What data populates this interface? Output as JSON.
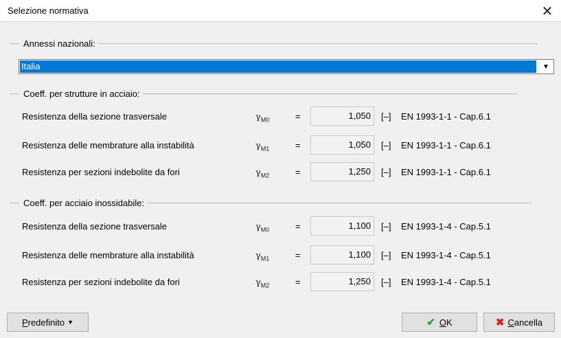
{
  "window": {
    "title": "Selezione normativa"
  },
  "annex": {
    "legend": "Annessi nazionali:",
    "selected": "Italia"
  },
  "steel": {
    "legend": "Coeff. per strutture in acciaio:",
    "rows": [
      {
        "label": "Resistenza della sezione trasversale",
        "symbol": "γ",
        "sub": "M0",
        "eq": "=",
        "value": "1,050",
        "unit": "[–]",
        "ref": "EN 1993-1-1 - Cap.6.1"
      },
      {
        "label": "Resistenza delle membrature alla instabilità",
        "symbol": "γ",
        "sub": "M1",
        "eq": "=",
        "value": "1,050",
        "unit": "[–]",
        "ref": "EN 1993-1-1 - Cap.6.1"
      },
      {
        "label": "Resistenza per sezioni indebolite da fori",
        "symbol": "γ",
        "sub": "M2",
        "eq": "=",
        "value": "1,250",
        "unit": "[–]",
        "ref": "EN 1993-1-1 - Cap.6.1"
      }
    ]
  },
  "stainless": {
    "legend": "Coeff. per acciaio inossidabile:",
    "rows": [
      {
        "label": "Resistenza della sezione trasversale",
        "symbol": "γ",
        "sub": "M0",
        "eq": "=",
        "value": "1,100",
        "unit": "[–]",
        "ref": "EN 1993-1-4 - Cap.5.1"
      },
      {
        "label": "Resistenza delle membrature alla instabilità",
        "symbol": "γ",
        "sub": "M1",
        "eq": "=",
        "value": "1,100",
        "unit": "[–]",
        "ref": "EN 1993-1-4 - Cap.5.1"
      },
      {
        "label": "Resistenza per sezioni indebolite da fori",
        "symbol": "γ",
        "sub": "M2",
        "eq": "=",
        "value": "1,250",
        "unit": "[–]",
        "ref": "EN 1993-1-4 - Cap.5.1"
      }
    ]
  },
  "buttons": {
    "default_first": "P",
    "default_rest": "redefinito",
    "ok_first": "O",
    "ok_rest": "K",
    "cancel_first": "C",
    "cancel_rest": "ancella"
  },
  "icons": {
    "close": "close-icon",
    "combo_arrow": "chevron-down-icon",
    "ok": "check-icon",
    "cancel": "x-icon",
    "dropdown": "triangle-down-icon"
  },
  "colors": {
    "selection": "#0078d7",
    "ok_check": "#2e9d2e",
    "cancel_x": "#d9261c"
  }
}
